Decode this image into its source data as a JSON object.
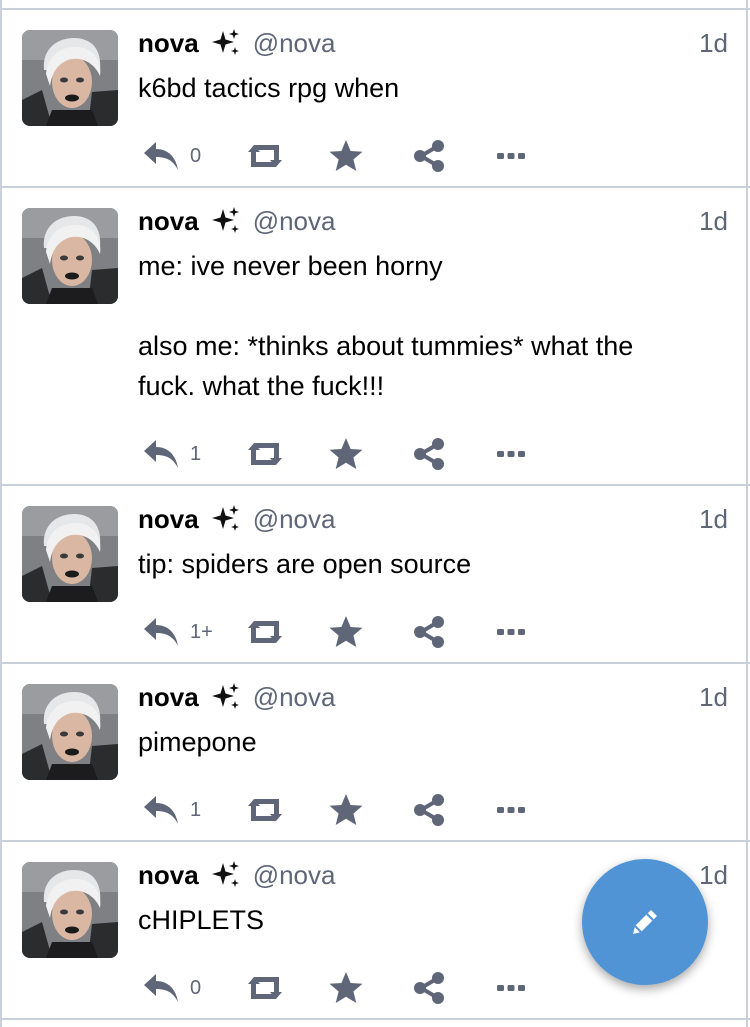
{
  "colors": {
    "icon": "#5f6678",
    "divider": "#c9d0dc",
    "fab": "#5094d6"
  },
  "statuses": [
    {
      "name": "nova",
      "handle": "@nova",
      "time": "1d",
      "content": "k6bd tactics rpg when",
      "reply_count": "0"
    },
    {
      "name": "nova",
      "handle": "@nova",
      "time": "1d",
      "content": "me: ive never been horny\n\nalso me: *thinks about tummies* what the\nfuck. what the fuck!!!",
      "reply_count": "1"
    },
    {
      "name": "nova",
      "handle": "@nova",
      "time": "1d",
      "content": "tip: spiders are open source",
      "reply_count": "1+"
    },
    {
      "name": "nova",
      "handle": "@nova",
      "time": "1d",
      "content": "pimepone",
      "reply_count": "1"
    },
    {
      "name": "nova",
      "handle": "@nova",
      "time": "1d",
      "content": "cHIPLETS",
      "reply_count": "0"
    }
  ],
  "icons": {
    "avatar": "avatar-photo",
    "sparkle": "sparkles-icon",
    "reply": "reply-icon",
    "boost": "boost-icon",
    "favourite": "star-icon",
    "share": "share-icon",
    "more": "more-icon",
    "compose": "pencil-icon"
  }
}
